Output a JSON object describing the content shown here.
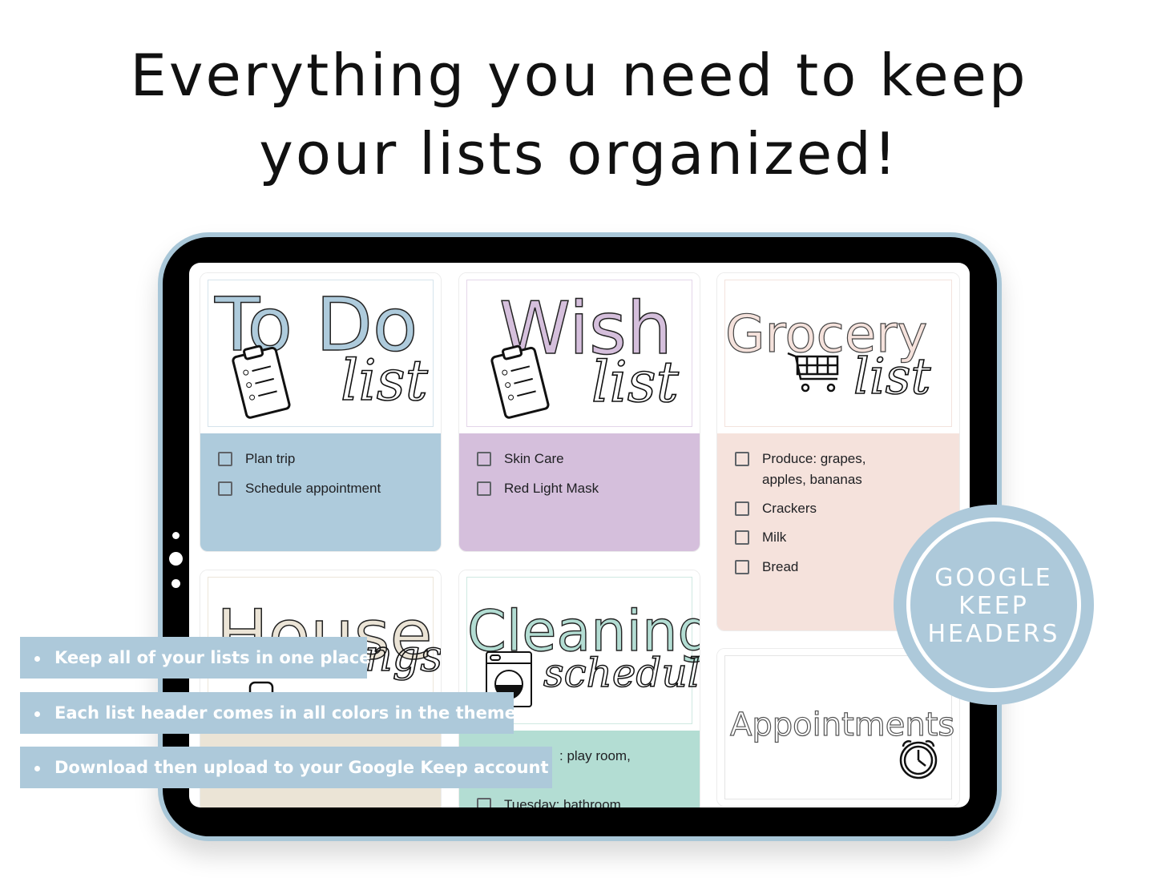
{
  "headline": {
    "line1": "Everything you need to keep",
    "line2": "your lists organized!"
  },
  "colors": {
    "tablet_frame": "#a9c7d8",
    "blue": "#aecbdc",
    "purple": "#d5bfdc",
    "pink": "#f5e2dc",
    "beige": "#ebe4d6",
    "teal": "#b3ddd3"
  },
  "cards": {
    "todo": {
      "title": "To Do",
      "script": "list",
      "icon": "clipboard-icon",
      "items": [
        "Plan trip",
        "Schedule appointment"
      ]
    },
    "wish": {
      "title": "Wish",
      "script": "list",
      "icon": "clipboard-icon",
      "items": [
        "Skin Care",
        "Red Light Mask"
      ]
    },
    "grocery": {
      "title": "Grocery",
      "script": "list",
      "icon": "shopping-cart-icon",
      "items": [
        "Produce: grapes, apples, bananas",
        "Crackers",
        "Milk",
        "Bread"
      ]
    },
    "house": {
      "title": "House",
      "script": "ngs",
      "icon": "house-icon"
    },
    "cleaning": {
      "title": "Cleaning",
      "script": "schedule",
      "icon": "washing-machine-icon",
      "items": [
        ": play room,",
        "Tuesday: bathroom"
      ]
    },
    "appointments": {
      "title": "Appointments",
      "icon": "alarm-clock-icon"
    }
  },
  "banners": [
    "Keep all of your lists in one place",
    "Each list header comes in all colors in the theme",
    "Download then upload to your Google Keep account"
  ],
  "badge": {
    "line1": "GOOGLE",
    "line2": "KEEP",
    "line3": "HEADERS"
  }
}
